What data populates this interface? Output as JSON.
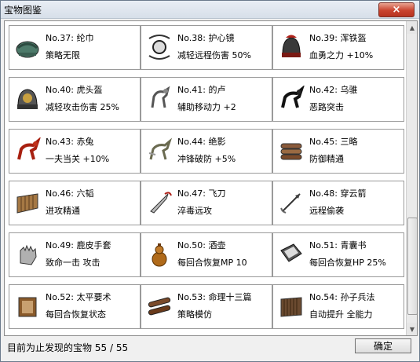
{
  "window": {
    "title": "宝物图鉴",
    "close_label": "×"
  },
  "items": [
    {
      "num": "No.37:",
      "name": "纶巾",
      "desc": "策略无限",
      "icon": "turban-icon"
    },
    {
      "num": "No.38:",
      "name": "护心镜",
      "desc": "减轻远程伤害 50%",
      "icon": "chest-mirror-icon"
    },
    {
      "num": "No.39:",
      "name": "浑铁盔",
      "desc": "血勇之力 +10%",
      "icon": "iron-helmet-icon"
    },
    {
      "num": "No.40:",
      "name": "虎头盔",
      "desc": "减轻攻击伤害 25%",
      "icon": "tiger-helmet-icon"
    },
    {
      "num": "No.41:",
      "name": "的卢",
      "desc": "辅助移动力 +2",
      "icon": "dilu-horse-icon"
    },
    {
      "num": "No.42:",
      "name": "乌骓",
      "desc": "恶路突击",
      "icon": "black-horse-icon"
    },
    {
      "num": "No.43:",
      "name": "赤兔",
      "desc": "一夫当关 +10%",
      "icon": "red-hare-horse-icon"
    },
    {
      "num": "No.44:",
      "name": "绝影",
      "desc": "冲锋破防 +5%",
      "icon": "shadow-horse-icon"
    },
    {
      "num": "No.45:",
      "name": "三略",
      "desc": "防御精通",
      "icon": "scroll-bundle-icon"
    },
    {
      "num": "No.46:",
      "name": "六韬",
      "desc": "进攻精通",
      "icon": "bamboo-scroll-icon"
    },
    {
      "num": "No.47:",
      "name": "飞刀",
      "desc": "淬毒远攻",
      "icon": "flying-knife-icon"
    },
    {
      "num": "No.48:",
      "name": "穿云箭",
      "desc": "远程偷袭",
      "icon": "arrow-icon"
    },
    {
      "num": "No.49:",
      "name": "鹿皮手套",
      "desc": "致命一击 攻击",
      "icon": "deerskin-glove-icon"
    },
    {
      "num": "No.50:",
      "name": "酒壶",
      "desc": "每回合恢复MP 10",
      "icon": "wine-gourd-icon"
    },
    {
      "num": "No.51:",
      "name": "青囊书",
      "desc": "每回合恢复HP 25%",
      "icon": "medical-book-icon"
    },
    {
      "num": "No.52:",
      "name": "太平要术",
      "desc": "每回合恢复状态",
      "icon": "taiping-book-icon"
    },
    {
      "num": "No.53:",
      "name": "命理十三篇",
      "desc": "策略模仿",
      "icon": "bamboo-slips-icon"
    },
    {
      "num": "No.54:",
      "name": "孙子兵法",
      "desc": "自动提升 全能力",
      "icon": "art-of-war-icon"
    }
  ],
  "footer": {
    "label": "目前为止发现的宝物",
    "found": "55",
    "separator": "/",
    "total": "55",
    "ok_label": "确定"
  },
  "colors": {
    "close_red": "#c9432e",
    "title_bar": "#dce3ec"
  }
}
